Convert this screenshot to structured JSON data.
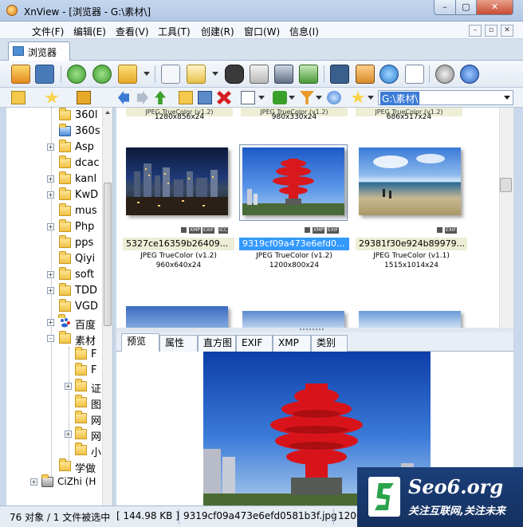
{
  "window": {
    "title": "XnView - [浏览器 - G:\\素材\\]",
    "controls": {
      "minimize": "–",
      "maximize": "▢",
      "close": "✕"
    }
  },
  "menu": {
    "items": [
      "文件(F)",
      "编辑(E)",
      "查看(V)",
      "工具(T)",
      "创建(R)",
      "窗口(W)",
      "信息(I)"
    ],
    "mdi_controls": [
      "–",
      "▫",
      "✕"
    ]
  },
  "browser_tab": {
    "label": "浏览器"
  },
  "address": {
    "value": "G:\\素材\\"
  },
  "tree": {
    "items": [
      {
        "label": "360l",
        "icon": "folder-icon",
        "expander": ""
      },
      {
        "label": "360s",
        "icon": "special-folder-icon",
        "expander": ""
      },
      {
        "label": "Asp",
        "icon": "folder-icon",
        "expander": "+"
      },
      {
        "label": "dcac",
        "icon": "folder-icon",
        "expander": ""
      },
      {
        "label": "kanl",
        "icon": "folder-icon",
        "expander": "+"
      },
      {
        "label": "KwD",
        "icon": "folder-icon",
        "expander": "+"
      },
      {
        "label": "mus",
        "icon": "folder-icon",
        "expander": ""
      },
      {
        "label": "Php",
        "icon": "folder-icon",
        "expander": "+"
      },
      {
        "label": "pps",
        "icon": "folder-icon",
        "expander": ""
      },
      {
        "label": "Qiyi",
        "icon": "folder-icon",
        "expander": ""
      },
      {
        "label": "soft",
        "icon": "folder-icon",
        "expander": "+"
      },
      {
        "label": "TDD",
        "icon": "folder-icon",
        "expander": "+"
      },
      {
        "label": "VGD",
        "icon": "folder-icon",
        "expander": ""
      },
      {
        "label": "百度",
        "icon": "baidu-icon",
        "expander": "+"
      },
      {
        "label": "素材",
        "icon": "folder-icon",
        "expander": "–"
      },
      {
        "label": "F",
        "icon": "folder-icon",
        "expander": ""
      },
      {
        "label": "F",
        "icon": "folder-icon",
        "expander": ""
      },
      {
        "label": "证",
        "icon": "folder-icon",
        "expander": "+"
      },
      {
        "label": "图",
        "icon": "folder-icon",
        "expander": ""
      },
      {
        "label": "网",
        "icon": "folder-icon",
        "expander": ""
      },
      {
        "label": "网",
        "icon": "folder-icon",
        "expander": "+"
      },
      {
        "label": "小",
        "icon": "folder-icon",
        "expander": ""
      },
      {
        "label": "学做",
        "icon": "folder-icon",
        "expander": ""
      },
      {
        "label": "CiZhi (H",
        "icon": "drive-icon",
        "expander": "+"
      }
    ]
  },
  "thumbnails": {
    "top_row": [
      {
        "caption": "JPEG TrueColor (v1.2)",
        "meta": "1280x856x24"
      },
      {
        "caption": "JPEG TrueColor (v1.2)",
        "meta": "980x330x24"
      },
      {
        "caption": "JPEG TrueColor (v1.2)",
        "meta": "686x517x24"
      }
    ],
    "main_row": [
      {
        "name": "5327ce16359b26409...",
        "format": "JPEG TrueColor (v1.2)",
        "dims": "960x640x24",
        "badges": [
          "XMP",
          "EXIF",
          "ICC"
        ],
        "selected": false
      },
      {
        "name": "9319cf09a473e6efd0...",
        "format": "JPEG TrueColor (v1.2)",
        "dims": "1200x800x24",
        "badges": [
          "XMP",
          "EXIF"
        ],
        "selected": true
      },
      {
        "name": "29381f30e924b89979...",
        "format": "JPEG TrueColor (v1.1)",
        "dims": "1515x1014x24",
        "badges": [
          "EXIF"
        ],
        "selected": false
      }
    ]
  },
  "preview_tabs": [
    "预览",
    "属性",
    "直方图",
    "EXIF",
    "XMP",
    "类别"
  ],
  "status": {
    "objects": "76 对象 / 1 文件被选中",
    "size": "[ 144.98 KB ]",
    "filename": "9319cf09a473e6efd0581b3f.jpg",
    "extra": "1200"
  },
  "watermark": {
    "domain": "Seo6.org",
    "slogan": "关注互联网,关注未来"
  },
  "colors": {
    "selection": "#3399ff",
    "caption_band": "#eeeed6",
    "watermark_bg": "#1b3f7a",
    "watermark_logo": "#2aa34a"
  }
}
